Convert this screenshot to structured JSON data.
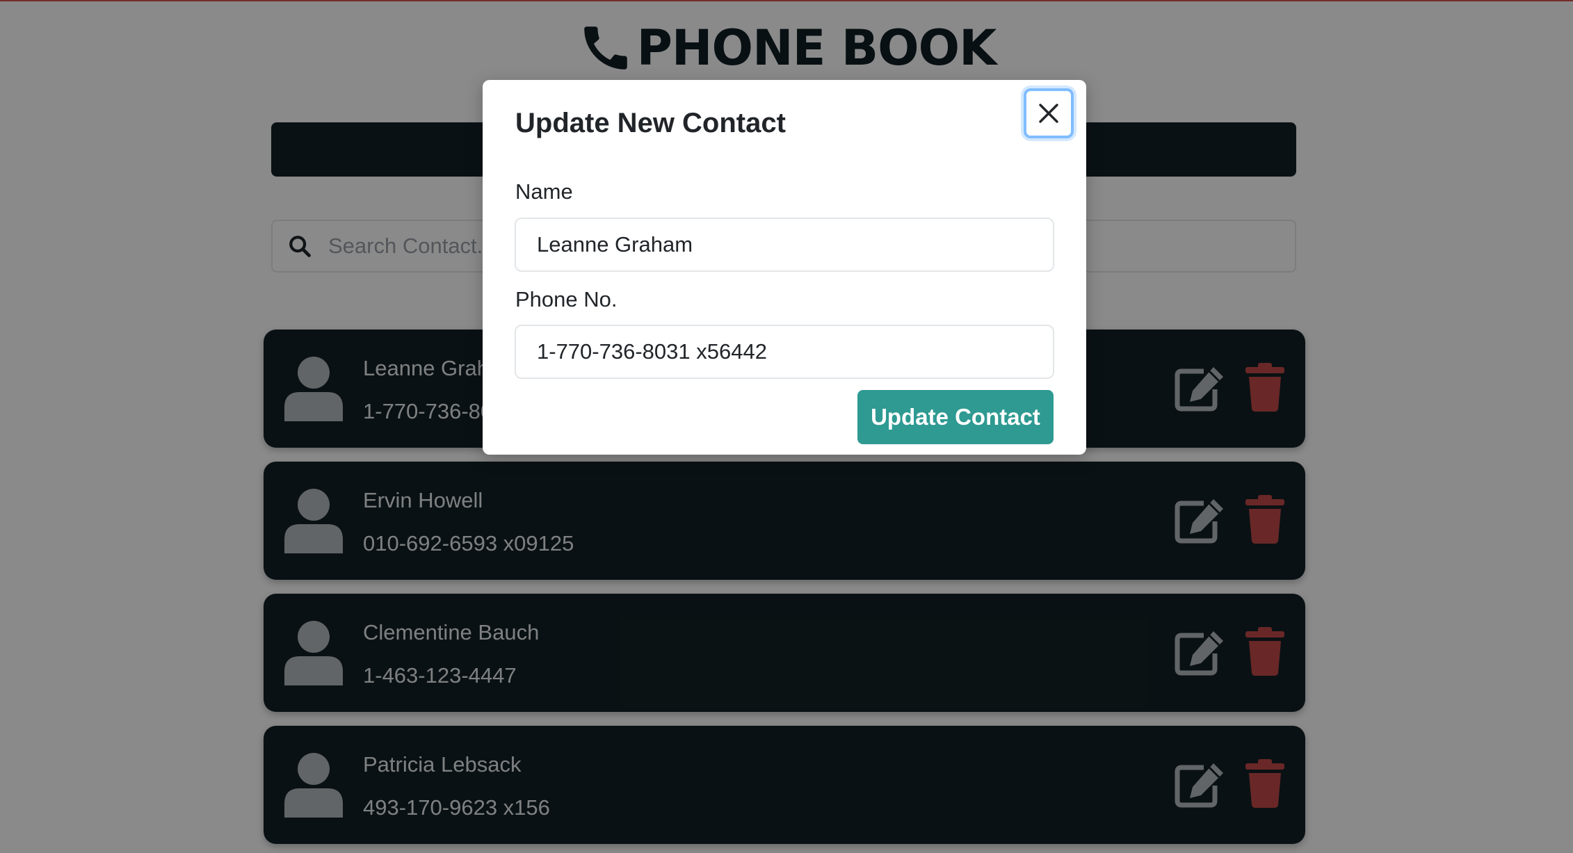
{
  "app": {
    "title": "PHONE BOOK",
    "search_placeholder": "Search Contact..."
  },
  "contacts": [
    {
      "name": "Leanne Graham",
      "phone": "1-770-736-8031 x56442"
    },
    {
      "name": "Ervin Howell",
      "phone": "010-692-6593 x09125"
    },
    {
      "name": "Clementine Bauch",
      "phone": "1-463-123-4447"
    },
    {
      "name": "Patricia Lebsack",
      "phone": "493-170-9623 x156"
    }
  ],
  "modal": {
    "title": "Update New Contact",
    "name_label": "Name",
    "name_value": "Leanne Graham",
    "phone_label": "Phone No.",
    "phone_value": "1-770-736-8031 x56442",
    "submit_label": "Update Contact"
  },
  "colors": {
    "card_bg": "#132125",
    "accent": "#2e9a92",
    "delete": "#c24a48",
    "icon_gray": "#b5bbbe"
  },
  "icons": {
    "title": "phone-icon",
    "search": "search-icon",
    "avatar": "user-icon",
    "edit": "edit-icon",
    "delete": "trash-icon",
    "close": "close-icon"
  }
}
